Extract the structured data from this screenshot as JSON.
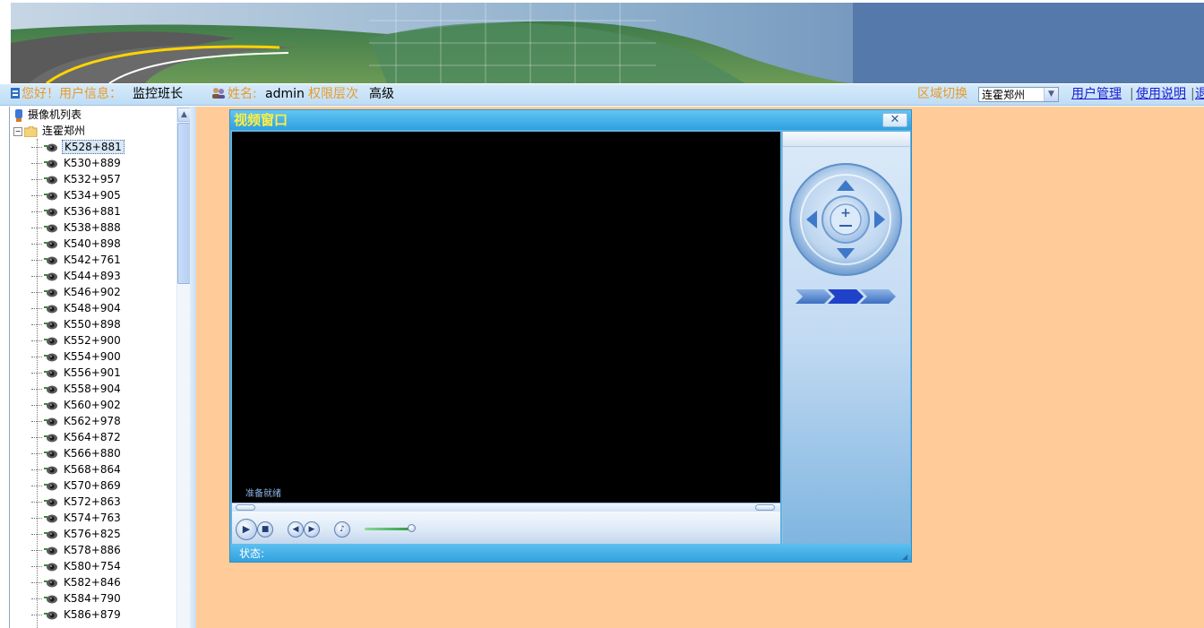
{
  "infobar": {
    "greeting_label": "您好！用户信息：",
    "role_value": "监控班长",
    "name_label": "姓名:",
    "name_value": "admin",
    "permission_label": "权限层次",
    "permission_value": "高级",
    "region_label": "区域切换",
    "region_selected": "连霍郑州",
    "user_mgmt_link": "用户管理",
    "help_link": "使用说明",
    "logout_link_partial": "退"
  },
  "tree": {
    "root_label": "摄像机列表",
    "group_label": "连霍郑州",
    "cameras": [
      "K528+881",
      "K530+889",
      "K532+957",
      "K534+905",
      "K536+881",
      "K538+888",
      "K540+898",
      "K542+761",
      "K544+893",
      "K546+902",
      "K548+904",
      "K550+898",
      "K552+900",
      "K554+900",
      "K556+901",
      "K558+904",
      "K560+902",
      "K562+978",
      "K564+872",
      "K566+880",
      "K568+864",
      "K570+869",
      "K572+863",
      "K574+763",
      "K576+825",
      "K578+886",
      "K580+754",
      "K582+846",
      "K584+790",
      "K586+879"
    ],
    "selected_index": 0
  },
  "video_window": {
    "title": "视频窗口",
    "close_icon": "close-x-icon",
    "screen_status": "准备就绪",
    "status_label": "状态:",
    "volume_level": 0.9
  },
  "colors": {
    "main_bg": "#ffcc99",
    "title_text": "#ffef40",
    "orange_text": "#e69a2b",
    "link": "#1d1dd0"
  }
}
